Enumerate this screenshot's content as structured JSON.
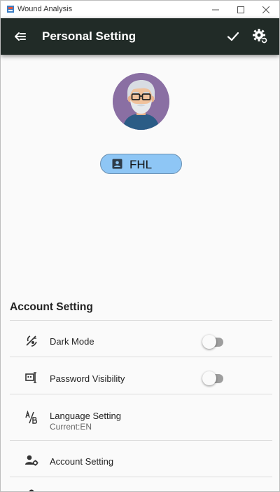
{
  "window": {
    "title": "Wound Analysis",
    "controls": [
      "minimize-icon",
      "maximize-icon",
      "close-icon"
    ]
  },
  "appbar": {
    "title": "Personal Setting",
    "back_icon": "back-arrow-icon",
    "confirm_icon": "check-icon",
    "settings_icon": "gear-reset-icon",
    "background": "#212b27"
  },
  "profile": {
    "avatar": "elderly-man-avatar",
    "name": "FHL",
    "chip_color": "#8ec6f5"
  },
  "account_section": {
    "title": "Account Setting",
    "items": [
      {
        "label": "Dark Mode",
        "icon": "dark-mode-icon",
        "toggle": false
      },
      {
        "label": "Password Visibility",
        "icon": "password-icon",
        "toggle": false
      },
      {
        "label": "Language Setting",
        "sub": "Current:EN",
        "icon": "translate-icon"
      },
      {
        "label": "Account Setting",
        "icon": "account-settings-icon"
      }
    ]
  }
}
